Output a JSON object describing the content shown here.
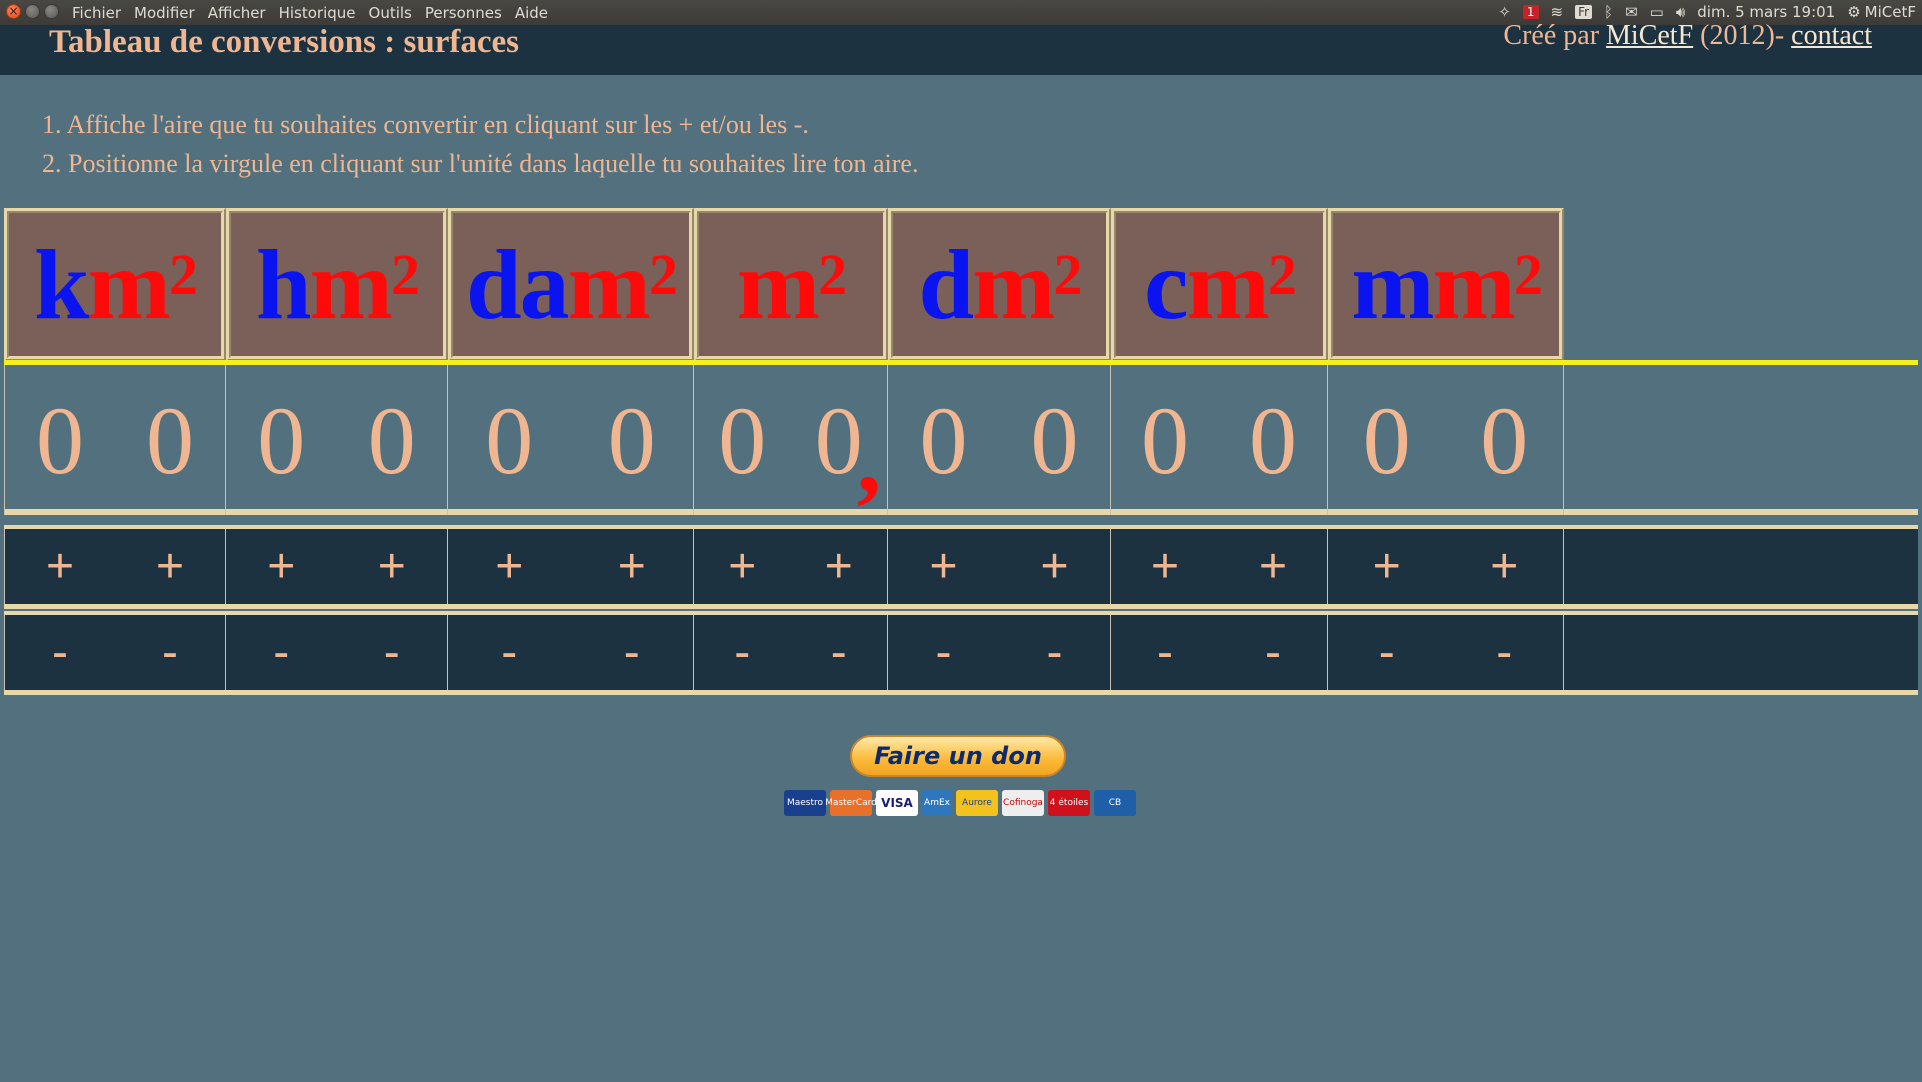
{
  "system_bar": {
    "menu": [
      "Fichier",
      "Modifier",
      "Afficher",
      "Historique",
      "Outils",
      "Personnes",
      "Aide"
    ],
    "notification_count": "1",
    "keyboard_layout": "Fr",
    "datetime": "dim. 5 mars 19:01",
    "user": "MiCetF"
  },
  "header": {
    "title": "Tableau de conversions : surfaces",
    "credit_prefix": "Créé par",
    "author_link": "MiCetF",
    "year": "(2012)-",
    "contact_link": "contact"
  },
  "instructions": [
    "1. Affiche l'aire que tu souhaites convertir en cliquant sur les + et/ou les -.",
    "2. Positionne la virgule en cliquant sur l'unité dans laquelle tu souhaites lire ton aire."
  ],
  "units": [
    {
      "prefix": "k",
      "base": "m",
      "exp": "2"
    },
    {
      "prefix": "h",
      "base": "m",
      "exp": "2"
    },
    {
      "prefix": "da",
      "base": "m",
      "exp": "2"
    },
    {
      "prefix": "",
      "base": "m",
      "exp": "2"
    },
    {
      "prefix": "d",
      "base": "m",
      "exp": "2"
    },
    {
      "prefix": "c",
      "base": "m",
      "exp": "2"
    },
    {
      "prefix": "m",
      "base": "m",
      "exp": "2"
    }
  ],
  "digits": [
    [
      "0",
      "0"
    ],
    [
      "0",
      "0"
    ],
    [
      "0",
      "0"
    ],
    [
      "0",
      "0"
    ],
    [
      "0",
      "0"
    ],
    [
      "0",
      "0"
    ],
    [
      "0",
      "0"
    ]
  ],
  "decimal_separator": ",",
  "plus_label": "+",
  "minus_label": "-",
  "donate_label": "Faire un don",
  "payment_cards": [
    "Maestro",
    "MasterCard",
    "VISA",
    "AmEx",
    "Aurore",
    "Cofinoga",
    "4 étoiles",
    "CB"
  ],
  "colors": {
    "prefix_blue": "#0a14f0",
    "base_red": "#ff0a0a",
    "text_salmon": "#f0b691",
    "background": "#52707d",
    "header_dark": "#1d3240"
  }
}
